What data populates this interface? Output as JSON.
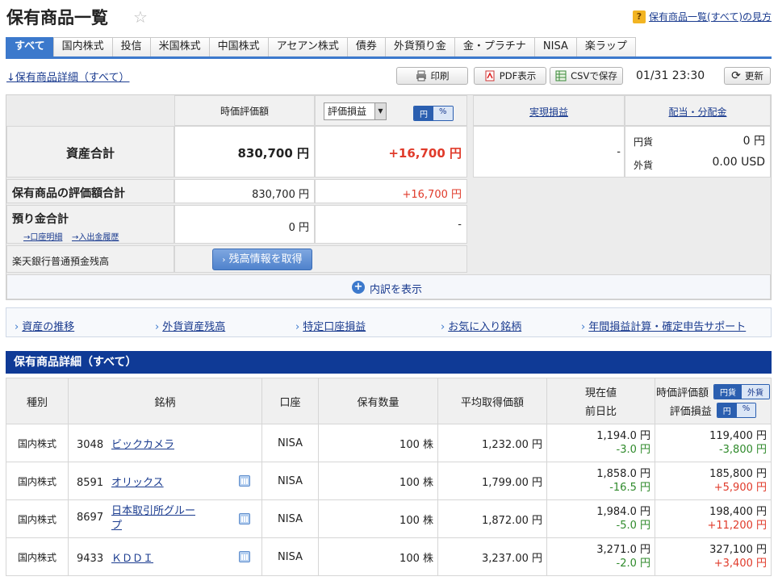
{
  "page": {
    "title": "保有商品一覧",
    "help_link": "保有商品一覧(すべて)の見方"
  },
  "tabs": [
    "すべて",
    "国内株式",
    "投信",
    "米国株式",
    "中国株式",
    "アセアン株式",
    "債券",
    "外貨預り金",
    "金・プラチナ",
    "NISA",
    "楽ラップ"
  ],
  "toolbar": {
    "detail_link": "↓保有商品詳細（すべて）",
    "print": "印刷",
    "pdf": "PDF表示",
    "csv": "CSVで保存",
    "timestamp": "01/31 23:30",
    "refresh": "更新"
  },
  "summary": {
    "col_valuation": "時価評価額",
    "col_pl_select": "評価損益",
    "seg_yen": "円",
    "seg_pct": "%",
    "col_realized": "実現損益",
    "col_dividend": "配当・分配金",
    "total_label": "資産合計",
    "total_value": "830,700 円",
    "total_pl": "+16,700 円",
    "realized_value": "-",
    "div_yen_label": "円貨",
    "div_yen_value": "0 円",
    "div_fx_label": "外貨",
    "div_fx_value": "0.00 USD",
    "holdings_label": "保有商品の評価額合計",
    "holdings_value": "830,700 円",
    "holdings_pl": "+16,700 円",
    "deposit_label": "預り金合計",
    "deposit_link1": "→口座明細",
    "deposit_link2": "→入出金履歴",
    "deposit_value": "0 円",
    "deposit_pl": "-",
    "bank_label": "楽天銀行普通預金残高",
    "bank_button": "残高情報を取得",
    "expand": "内訳を表示"
  },
  "links": [
    "資産の推移",
    "外貨資産残高",
    "特定口座損益",
    "お気に入り銘柄",
    "年間損益計算・確定申告サポート"
  ],
  "detail": {
    "header": "保有商品詳細（すべて）",
    "columns": {
      "type": "種別",
      "name": "銘柄",
      "account": "口座",
      "qty": "保有数量",
      "avg": "平均取得価額",
      "price": "現在値",
      "change": "前日比",
      "valuation": "時価評価額",
      "pl": "評価損益",
      "seg_jpy": "円貨",
      "seg_fx": "外貨",
      "seg_yen": "円",
      "seg_pct": "%"
    },
    "rows": [
      {
        "type": "国内株式",
        "code": "3048",
        "name": "ビックカメラ",
        "account": "NISA",
        "qty": "100 株",
        "avg": "1,232.00 円",
        "price": "1,194.0 円",
        "change": "-3.0 円",
        "valuation": "119,400 円",
        "pl": "-3,800 円"
      },
      {
        "type": "国内株式",
        "code": "8591",
        "name": "オリックス",
        "account": "NISA",
        "qty": "100 株",
        "avg": "1,799.00 円",
        "price": "1,858.0 円",
        "change": "-16.5 円",
        "valuation": "185,800 円",
        "pl": "+5,900 円"
      },
      {
        "type": "国内株式",
        "code": "8697",
        "name": "日本取引所グループ",
        "account": "NISA",
        "qty": "100 株",
        "avg": "1,872.00 円",
        "price": "1,984.0 円",
        "change": "-5.0 円",
        "valuation": "198,400 円",
        "pl": "+11,200 円"
      },
      {
        "type": "国内株式",
        "code": "9433",
        "name": "ＫＤＤＩ",
        "account": "NISA",
        "qty": "100 株",
        "avg": "3,237.00 円",
        "price": "3,271.0 円",
        "change": "-2.0 円",
        "valuation": "327,100 円",
        "pl": "+3,400 円"
      }
    ]
  },
  "colors": {
    "accent": "#3c79cc",
    "section": "#0f3a96",
    "gain": "#e03a2a",
    "loss": "#2f8a2b"
  }
}
